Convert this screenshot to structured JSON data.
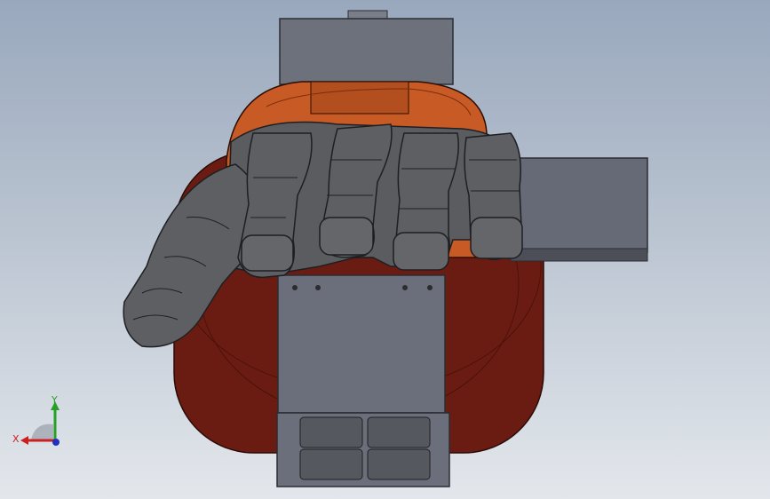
{
  "viewport": {
    "background_top": "#99a8bd",
    "background_bottom": "#e3e7ec"
  },
  "model": {
    "part_colors": {
      "frame": "#6b6f7b",
      "frame_dark": "#4a4d56",
      "finger_shell": "#5a5c60",
      "finger_edge": "#1e1f22",
      "orange_band": "#c85a25",
      "dark_red_body": "#6a1c12"
    }
  },
  "triad": {
    "x_label": "X",
    "y_label": "Y",
    "x_color": "#cc2020",
    "y_color": "#28a028",
    "z_color": "#2030c0"
  }
}
